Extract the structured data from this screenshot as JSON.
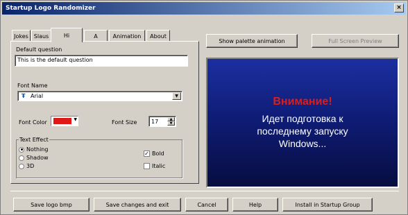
{
  "window": {
    "title": "Startup Logo Randomizer",
    "close_glyph": "×"
  },
  "tabs": [
    {
      "label": "Jokes"
    },
    {
      "label": "Slaus"
    },
    {
      "label": "Hi"
    },
    {
      "label": "A"
    },
    {
      "label": "Animation"
    },
    {
      "label": "About"
    }
  ],
  "form": {
    "default_question_label": "Default question",
    "default_question_value": "This is the default question",
    "font_name_label": "Font Name",
    "font_name_value": "Arial",
    "font_icon": "Ŧ",
    "font_color_label": "Font Color",
    "font_color_value": "#e01818",
    "font_size_label": "Font Size",
    "font_size_value": "17",
    "text_effect_label": "Text Effect",
    "effects": [
      {
        "label": "Nothing",
        "selected": true
      },
      {
        "label": "Shadow",
        "selected": false
      },
      {
        "label": "3D",
        "selected": false
      }
    ],
    "bold_label": "Bold",
    "bold_checked": true,
    "bold_check_glyph": "✓",
    "italic_label": "Italic",
    "italic_checked": false
  },
  "preview_buttons": {
    "show_palette": "Show palette animation",
    "full_screen": "Full Screen Preview"
  },
  "preview": {
    "warning": "Внимание!",
    "message_line1": "Идет подготовка к",
    "message_line2": "последнему запуску",
    "message_line3": "Windows..."
  },
  "bottom_buttons": {
    "save_logo": "Save logo bmp",
    "save_exit": "Save changes and exit",
    "cancel": "Cancel",
    "help": "Help",
    "install": "Install in Startup Group"
  }
}
